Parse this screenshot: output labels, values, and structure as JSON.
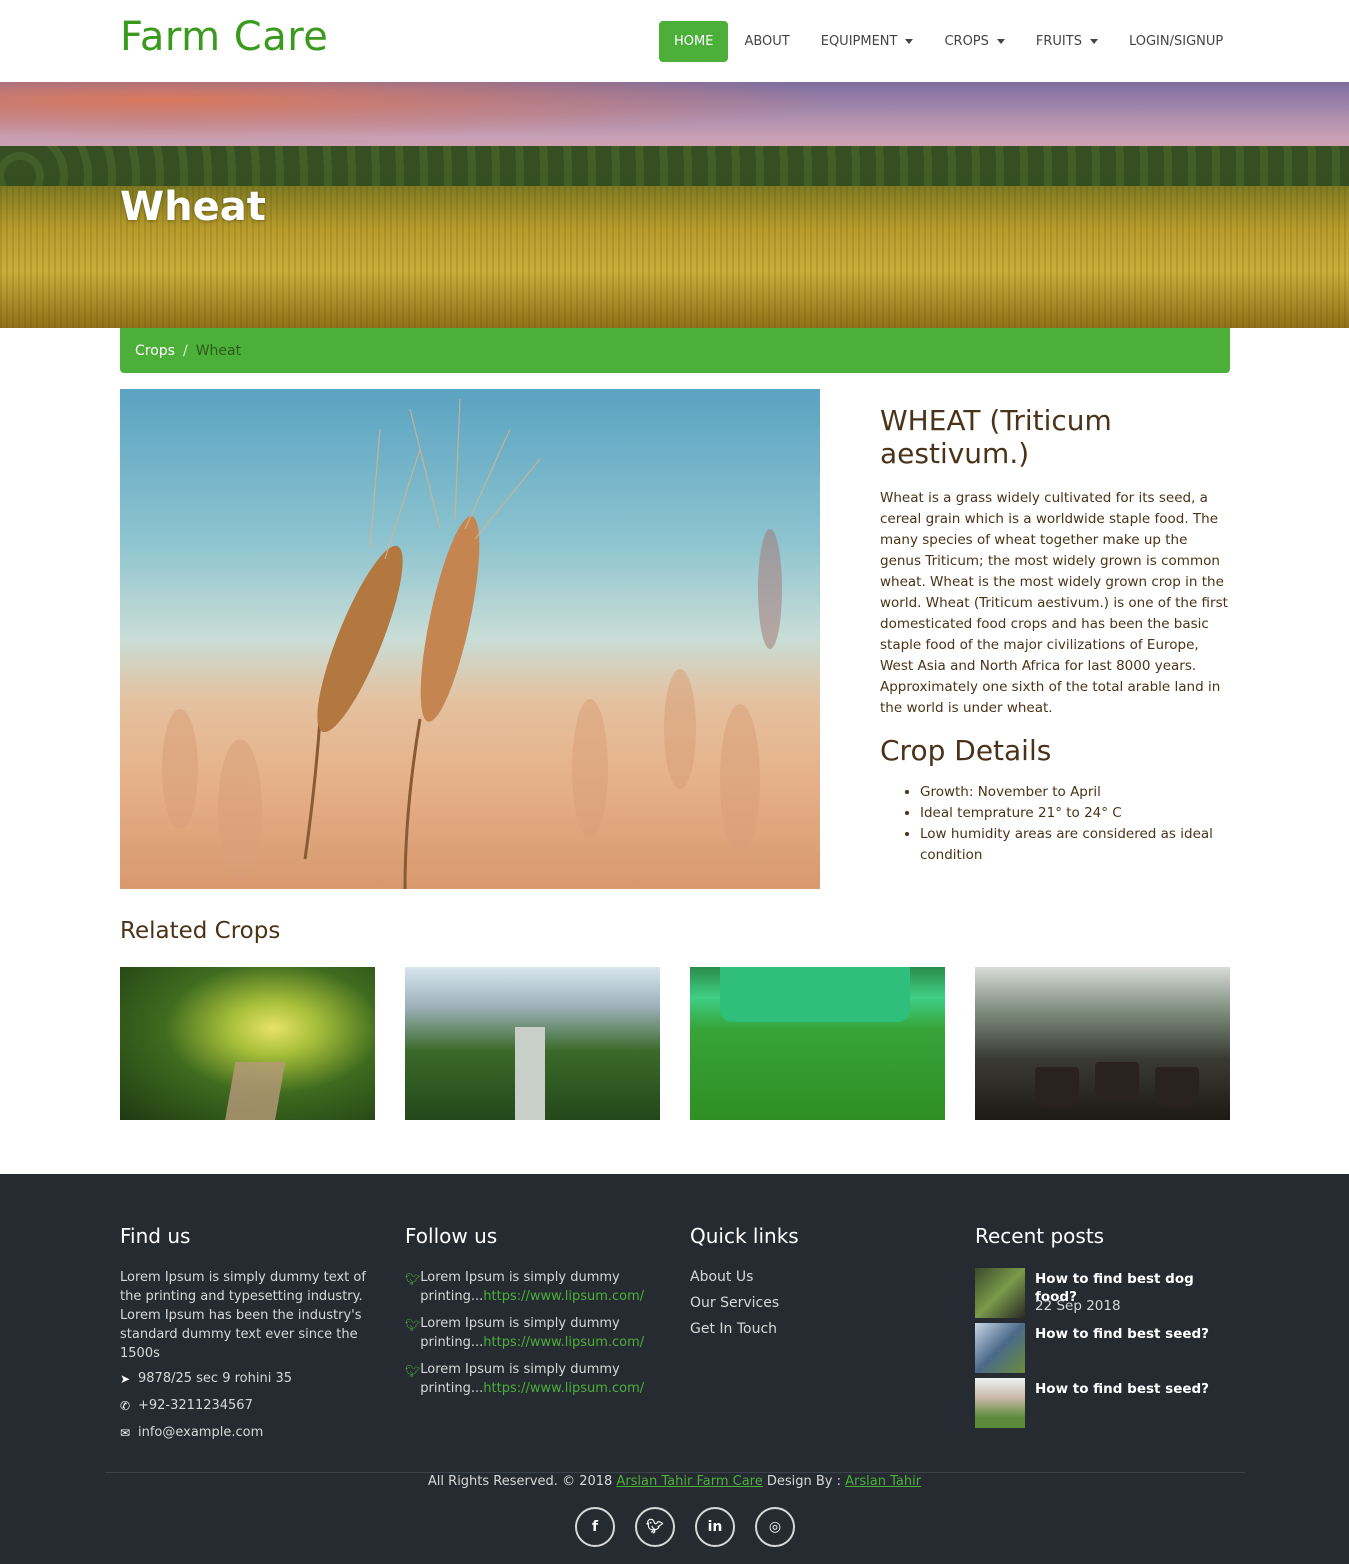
{
  "header": {
    "brand": "Farm Care",
    "nav": [
      {
        "label": "HOME",
        "active": true
      },
      {
        "label": "ABOUT"
      },
      {
        "label": "EQUIPMENT",
        "dropdown": true
      },
      {
        "label": "CROPS",
        "dropdown": true
      },
      {
        "label": "FRUITS",
        "dropdown": true
      },
      {
        "label": "LOGIN/SIGNUP"
      }
    ]
  },
  "hero": {
    "title": "Wheat"
  },
  "breadcrumb": {
    "parent": "Crops",
    "separator": "/",
    "current": "Wheat"
  },
  "crop": {
    "title": "WHEAT (Triticum aestivum.)",
    "description": "Wheat is a grass widely cultivated for its seed, a cereal grain which is a worldwide staple food. The many species of wheat together make up the genus Triticum; the most widely grown is common wheat. Wheat is the most widely grown crop in the world. Wheat (Triticum aestivum.) is one of the first domesticated food crops and has been the basic staple food of the major civilizations of Europe, West Asia and North Africa for last 8000 years. Approximately one sixth of the total arable land in the world is under wheat.",
    "details_title": "Crop Details",
    "details": [
      "Growth: November to April",
      "Ideal temprature 21° to 24° C",
      "Low humidity areas are considered as ideal condition"
    ]
  },
  "related": {
    "title": "Related Crops"
  },
  "footer": {
    "find_us": {
      "title": "Find us",
      "text": "Lorem Ipsum is simply dummy text of the printing and typesetting industry. Lorem Ipsum has been the industry's standard dummy text ever since the 1500s",
      "address": "9878/25 sec 9 rohini 35",
      "phone": "+92-3211234567",
      "email": "info@example.com"
    },
    "follow_us": {
      "title": "Follow us",
      "tweets": [
        {
          "text": "Lorem Ipsum is simply dummy printing...",
          "link": "https://www.lipsum.com/"
        },
        {
          "text": "Lorem Ipsum is simply dummy printing...",
          "link": "https://www.lipsum.com/"
        },
        {
          "text": "Lorem Ipsum is simply dummy printing...",
          "link": "https://www.lipsum.com/"
        }
      ]
    },
    "quick_links": {
      "title": "Quick links",
      "links": [
        "About Us",
        "Our Services",
        "Get In Touch"
      ]
    },
    "recent_posts": {
      "title": "Recent posts",
      "posts": [
        {
          "title": "How to find best dog food?",
          "date": "22 Sep 2018"
        },
        {
          "title": "How to find best seed?"
        },
        {
          "title": "How to find best seed?"
        }
      ]
    },
    "copyright": {
      "prefix": "All Rights Reserved. © 2018",
      "company": "Arslan Tahir Farm Care",
      "design_by": "Design By :",
      "designer": "Arslan Tahir"
    },
    "socials": [
      "facebook",
      "twitter",
      "linkedin",
      "instagram"
    ]
  },
  "colors": {
    "accent": "#4caf3a",
    "brand": "#3a9a1c",
    "text": "#4a3318",
    "footer_bg": "#252b31"
  }
}
